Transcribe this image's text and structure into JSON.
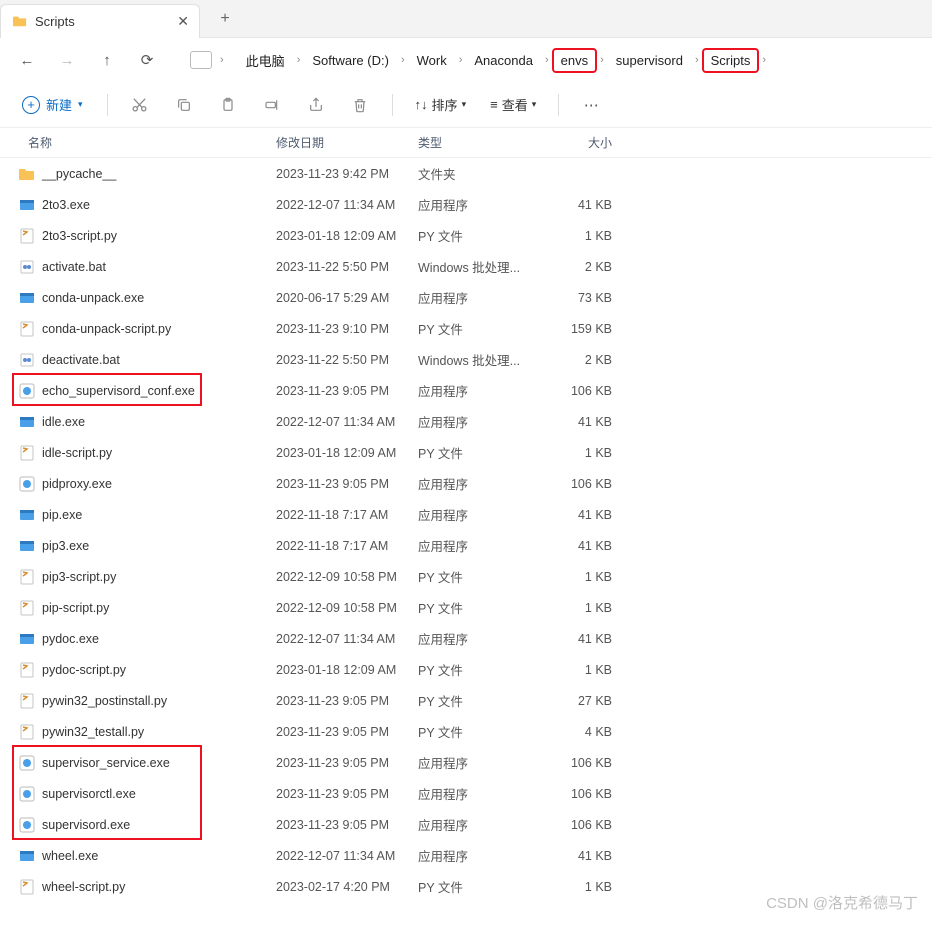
{
  "tab": {
    "title": "Scripts"
  },
  "breadcrumbs": {
    "items": [
      "此电脑",
      "Software (D:)",
      "Work",
      "Anaconda",
      "envs",
      "supervisord",
      "Scripts"
    ],
    "highlighted": [
      4,
      6
    ]
  },
  "toolbar": {
    "new_label": "新建",
    "sort_label": "排序",
    "view_label": "查看"
  },
  "columns": {
    "name": "名称",
    "date": "修改日期",
    "type": "类型",
    "size": "大小"
  },
  "files": [
    {
      "icon": "folder",
      "name": "__pycache__",
      "date": "2023-11-23 9:42 PM",
      "type": "文件夹",
      "size": ""
    },
    {
      "icon": "exe",
      "name": "2to3.exe",
      "date": "2022-12-07 11:34 AM",
      "type": "应用程序",
      "size": "41 KB"
    },
    {
      "icon": "py",
      "name": "2to3-script.py",
      "date": "2023-01-18 12:09 AM",
      "type": "PY 文件",
      "size": "1 KB"
    },
    {
      "icon": "bat",
      "name": "activate.bat",
      "date": "2023-11-22 5:50 PM",
      "type": "Windows 批处理...",
      "size": "2 KB"
    },
    {
      "icon": "exe",
      "name": "conda-unpack.exe",
      "date": "2020-06-17 5:29 AM",
      "type": "应用程序",
      "size": "73 KB"
    },
    {
      "icon": "py",
      "name": "conda-unpack-script.py",
      "date": "2023-11-23 9:10 PM",
      "type": "PY 文件",
      "size": "159 KB"
    },
    {
      "icon": "bat",
      "name": "deactivate.bat",
      "date": "2023-11-22 5:50 PM",
      "type": "Windows 批处理...",
      "size": "2 KB"
    },
    {
      "icon": "exe2",
      "name": "echo_supervisord_conf.exe",
      "date": "2023-11-23 9:05 PM",
      "type": "应用程序",
      "size": "106 KB"
    },
    {
      "icon": "exe",
      "name": "idle.exe",
      "date": "2022-12-07 11:34 AM",
      "type": "应用程序",
      "size": "41 KB"
    },
    {
      "icon": "py",
      "name": "idle-script.py",
      "date": "2023-01-18 12:09 AM",
      "type": "PY 文件",
      "size": "1 KB"
    },
    {
      "icon": "exe2",
      "name": "pidproxy.exe",
      "date": "2023-11-23 9:05 PM",
      "type": "应用程序",
      "size": "106 KB"
    },
    {
      "icon": "exe",
      "name": "pip.exe",
      "date": "2022-11-18 7:17 AM",
      "type": "应用程序",
      "size": "41 KB"
    },
    {
      "icon": "exe",
      "name": "pip3.exe",
      "date": "2022-11-18 7:17 AM",
      "type": "应用程序",
      "size": "41 KB"
    },
    {
      "icon": "py",
      "name": "pip3-script.py",
      "date": "2022-12-09 10:58 PM",
      "type": "PY 文件",
      "size": "1 KB"
    },
    {
      "icon": "py",
      "name": "pip-script.py",
      "date": "2022-12-09 10:58 PM",
      "type": "PY 文件",
      "size": "1 KB"
    },
    {
      "icon": "exe",
      "name": "pydoc.exe",
      "date": "2022-12-07 11:34 AM",
      "type": "应用程序",
      "size": "41 KB"
    },
    {
      "icon": "py",
      "name": "pydoc-script.py",
      "date": "2023-01-18 12:09 AM",
      "type": "PY 文件",
      "size": "1 KB"
    },
    {
      "icon": "py",
      "name": "pywin32_postinstall.py",
      "date": "2023-11-23 9:05 PM",
      "type": "PY 文件",
      "size": "27 KB"
    },
    {
      "icon": "py",
      "name": "pywin32_testall.py",
      "date": "2023-11-23 9:05 PM",
      "type": "PY 文件",
      "size": "4 KB"
    },
    {
      "icon": "exe2",
      "name": "supervisor_service.exe",
      "date": "2023-11-23 9:05 PM",
      "type": "应用程序",
      "size": "106 KB"
    },
    {
      "icon": "exe2",
      "name": "supervisorctl.exe",
      "date": "2023-11-23 9:05 PM",
      "type": "应用程序",
      "size": "106 KB"
    },
    {
      "icon": "exe2",
      "name": "supervisord.exe",
      "date": "2023-11-23 9:05 PM",
      "type": "应用程序",
      "size": "106 KB"
    },
    {
      "icon": "exe",
      "name": "wheel.exe",
      "date": "2022-12-07 11:34 AM",
      "type": "应用程序",
      "size": "41 KB"
    },
    {
      "icon": "py",
      "name": "wheel-script.py",
      "date": "2023-02-17 4:20 PM",
      "type": "PY 文件",
      "size": "1 KB"
    }
  ],
  "file_highlights": {
    "boxes": [
      {
        "start": 7,
        "end": 7
      },
      {
        "start": 19,
        "end": 21
      }
    ]
  },
  "watermark": "CSDN @洛克希德马丁"
}
